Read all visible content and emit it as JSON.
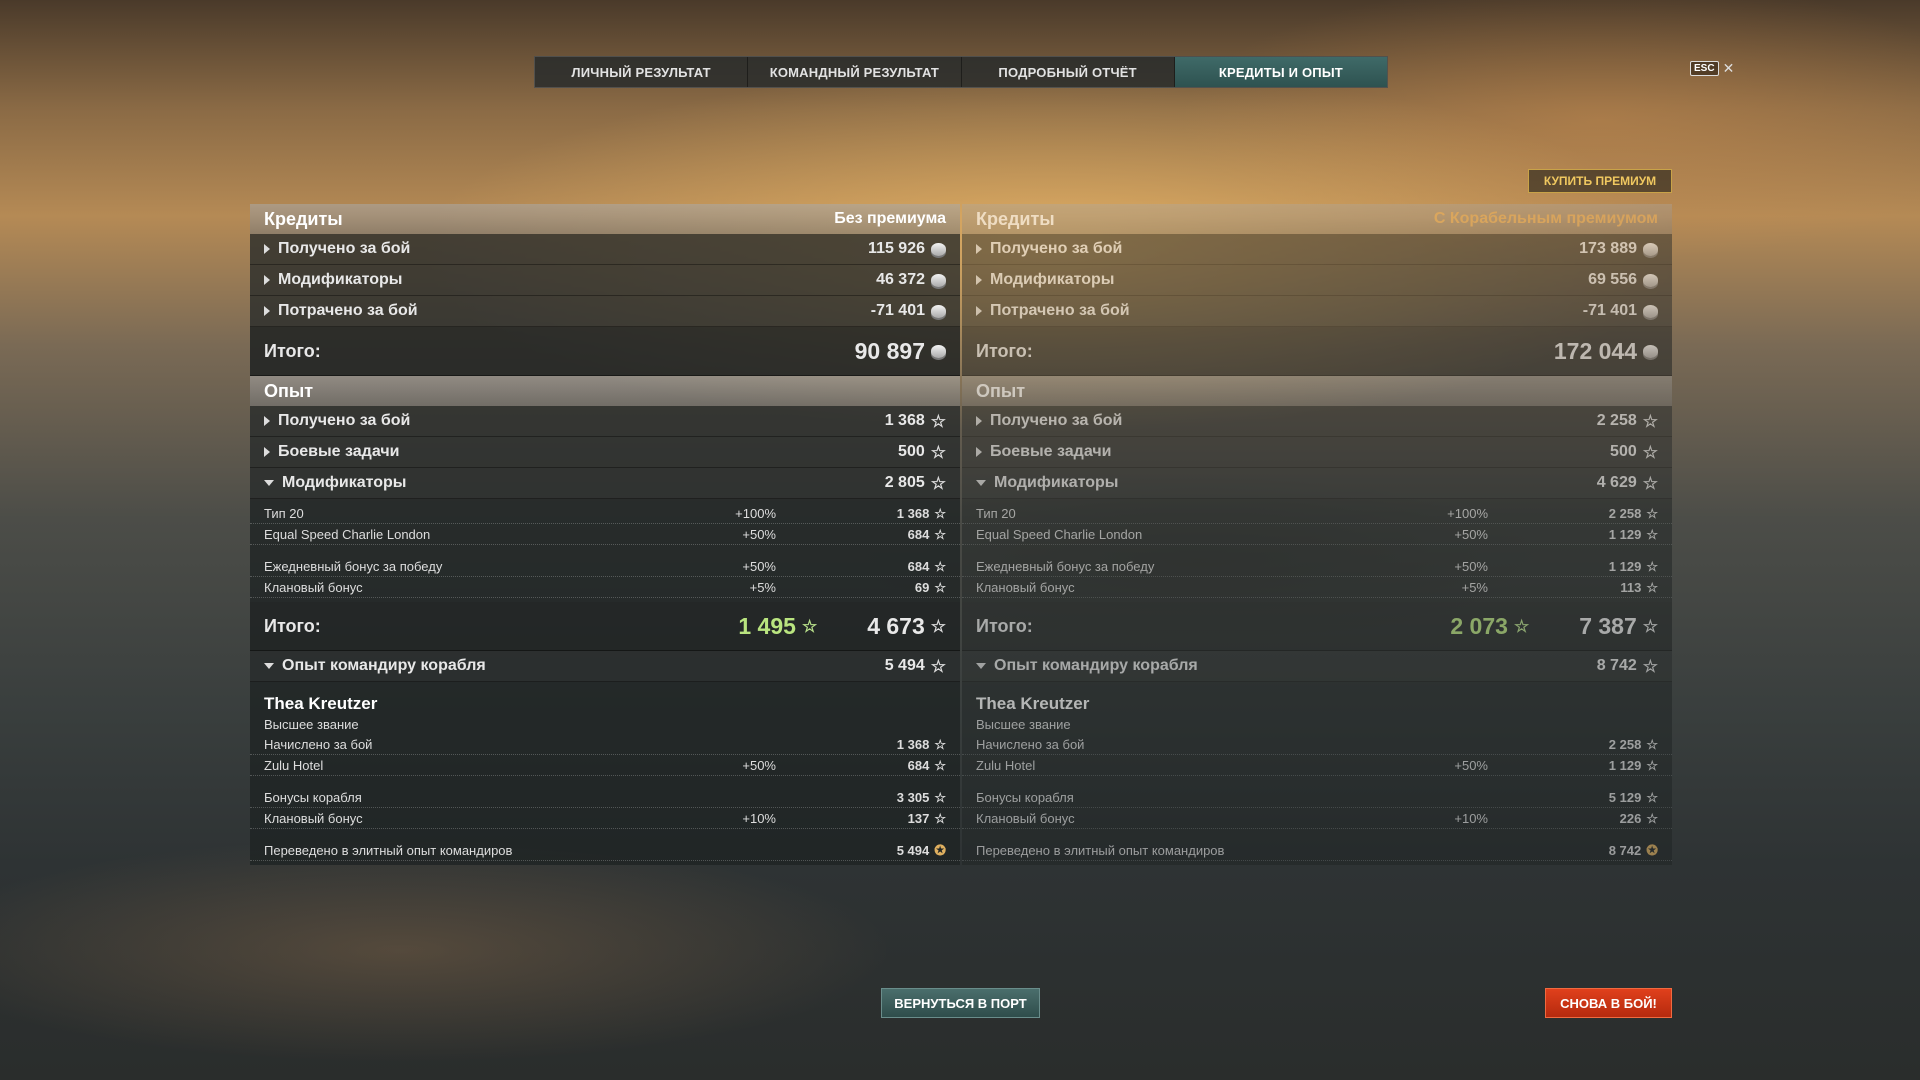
{
  "tabs": [
    {
      "label": "ЛИЧНЫЙ РЕЗУЛЬТАТ"
    },
    {
      "label": "КОМАНДНЫЙ РЕЗУЛЬТАТ"
    },
    {
      "label": "ПОДРОБНЫЙ ОТЧЁТ"
    },
    {
      "label": "КРЕДИТЫ И ОПЫТ",
      "active": true
    }
  ],
  "esc": {
    "key": "ESC",
    "close": "✕"
  },
  "buy_premium": "КУПИТЬ ПРЕМИУМ",
  "left": {
    "credits_title": "Кредиты",
    "column": "Без премиума",
    "credits_rows": [
      {
        "label": "Получено за бой",
        "value": "115 926"
      },
      {
        "label": "Модификаторы",
        "value": "46 372"
      },
      {
        "label": "Потрачено за бой",
        "value": "-71 401"
      }
    ],
    "credits_total_label": "Итого:",
    "credits_total": "90 897",
    "xp_title": "Опыт",
    "xp_rows": [
      {
        "label": "Получено за бой",
        "value": "1 368"
      },
      {
        "label": "Боевые задачи",
        "value": "500"
      },
      {
        "label": "Модификаторы",
        "value": "2 805"
      }
    ],
    "xp_mods": [
      {
        "label": "Тип 20",
        "pct": "+100%",
        "value": "1 368"
      },
      {
        "label": "Equal Speed Charlie London",
        "pct": "+50%",
        "value": "684"
      },
      {
        "label": "Ежедневный бонус за победу",
        "pct": "+50%",
        "value": "684"
      },
      {
        "label": "Клановый бонус",
        "pct": "+5%",
        "value": "69"
      }
    ],
    "xp_total_label": "Итого:",
    "xp_total_free": "1 495",
    "xp_total": "4 673",
    "cmdr_title": "Опыт командиру корабля",
    "cmdr_value": "5 494",
    "cmdr_name": "Thea Kreutzer",
    "cmdr_rank": "Высшее звание",
    "cmdr_rows": [
      {
        "label": "Начислено за бой",
        "pct": "",
        "value": "1 368"
      },
      {
        "label": "Zulu Hotel",
        "pct": "+50%",
        "value": "684"
      },
      {
        "label": "Бонусы корабля",
        "pct": "",
        "value": "3 305"
      },
      {
        "label": "Клановый бонус",
        "pct": "+10%",
        "value": "137"
      }
    ],
    "elite_label": "Переведено в элитный опыт командиров",
    "elite_value": "5 494"
  },
  "right": {
    "credits_title": "Кредиты",
    "column": "С Корабельным премиумом",
    "credits_rows": [
      {
        "label": "Получено за бой",
        "value": "173 889"
      },
      {
        "label": "Модификаторы",
        "value": "69 556"
      },
      {
        "label": "Потрачено за бой",
        "value": "-71 401"
      }
    ],
    "credits_total_label": "Итого:",
    "credits_total": "172 044",
    "xp_title": "Опыт",
    "xp_rows": [
      {
        "label": "Получено за бой",
        "value": "2 258"
      },
      {
        "label": "Боевые задачи",
        "value": "500"
      },
      {
        "label": "Модификаторы",
        "value": "4 629"
      }
    ],
    "xp_mods": [
      {
        "label": "Тип 20",
        "pct": "+100%",
        "value": "2 258"
      },
      {
        "label": "Equal Speed Charlie London",
        "pct": "+50%",
        "value": "1 129"
      },
      {
        "label": "Ежедневный бонус за победу",
        "pct": "+50%",
        "value": "1 129"
      },
      {
        "label": "Клановый бонус",
        "pct": "+5%",
        "value": "113"
      }
    ],
    "xp_total_label": "Итого:",
    "xp_total_free": "2 073",
    "xp_total": "7 387",
    "cmdr_title": "Опыт командиру корабля",
    "cmdr_value": "8 742",
    "cmdr_name": "Thea Kreutzer",
    "cmdr_rank": "Высшее звание",
    "cmdr_rows": [
      {
        "label": "Начислено за бой",
        "pct": "",
        "value": "2 258"
      },
      {
        "label": "Zulu Hotel",
        "pct": "+50%",
        "value": "1 129"
      },
      {
        "label": "Бонусы корабля",
        "pct": "",
        "value": "5 129"
      },
      {
        "label": "Клановый бонус",
        "pct": "+10%",
        "value": "226"
      }
    ],
    "elite_label": "Переведено в элитный опыт командиров",
    "elite_value": "8 742"
  },
  "buttons": {
    "port": "ВЕРНУТЬСЯ В ПОРТ",
    "battle": "СНОВА В БОЙ!"
  },
  "colors": {
    "accent_tab": "#3f6a68",
    "premium": "#c9a348",
    "battle": "#d23a16",
    "free_xp": "#b9e47f"
  }
}
